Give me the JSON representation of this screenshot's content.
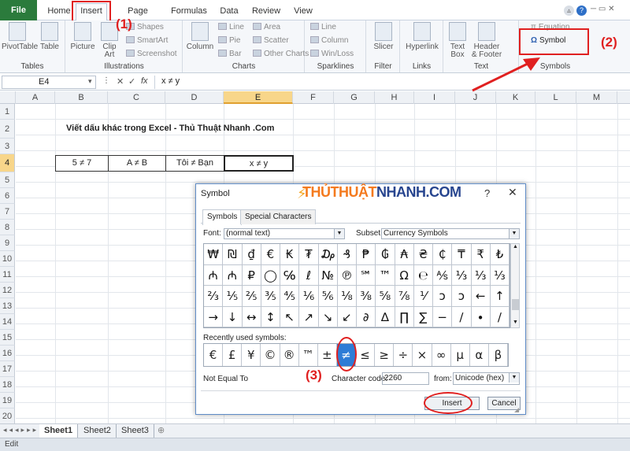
{
  "ribbon_tabs": [
    "File",
    "Home",
    "Insert",
    "Page Layout",
    "Formulas",
    "Data",
    "Review",
    "View"
  ],
  "ribbon": {
    "groups": {
      "tables": "Tables",
      "illustrations": "Illustrations",
      "charts": "Charts",
      "sparklines": "Sparklines",
      "filter": "Filter",
      "links": "Links",
      "text": "Text",
      "symbols": "Symbols"
    },
    "buttons": {
      "pivottable": "PivotTable",
      "table": "Table",
      "picture": "Picture",
      "clipart": "Clip Art",
      "shapes": "Shapes",
      "smartart": "SmartArt",
      "screenshot": "Screenshot",
      "column": "Column",
      "line": "Line",
      "pie": "Pie",
      "bar": "Bar",
      "area": "Area",
      "scatter": "Scatter",
      "other_charts": "Other Charts",
      "spark_line": "Line",
      "spark_column": "Column",
      "winloss": "Win/Loss",
      "slicer": "Slicer",
      "hyperlink": "Hyperlink",
      "textbox": "Text Box",
      "header_footer": "Header & Footer",
      "equation": "Equation",
      "symbol": "Symbol"
    }
  },
  "annotations": {
    "one": "(1)",
    "two": "(2)",
    "three": "(3)"
  },
  "formula_bar": {
    "name_box": "E4",
    "fx": "fx",
    "formula": "x ≠ y"
  },
  "columns": [
    "A",
    "B",
    "C",
    "D",
    "E",
    "F",
    "G",
    "H",
    "I",
    "J",
    "K",
    "L",
    "M"
  ],
  "rows": [
    "1",
    "2",
    "3",
    "4",
    "5",
    "6",
    "7",
    "8",
    "9",
    "10",
    "11",
    "12",
    "13",
    "14",
    "15",
    "16",
    "17",
    "18",
    "19",
    "20"
  ],
  "sheet": {
    "title": "Viết dấu khác trong Excel - Thủ Thuật Nhanh .Com",
    "cells": [
      "5 ≠ 7",
      "A ≠ B",
      "Tôi ≠ Bạn",
      "x ≠ y"
    ]
  },
  "sheet_tabs": [
    "Sheet1",
    "Sheet2",
    "Sheet3"
  ],
  "status": "Edit",
  "dialog": {
    "title": "Symbol",
    "brand_a": "THỦTHUẬT",
    "brand_b": "NHANH",
    "brand_c": ".COM",
    "help": "?",
    "close": "✕",
    "tabs": [
      "Symbols",
      "Special Characters"
    ],
    "font_label": "Font:",
    "font_value": "(normal text)",
    "subset_label": "Subset:",
    "subset_value": "Currency Symbols",
    "symbols": [
      "₩",
      "₪",
      "₫",
      "€",
      "₭",
      "₮",
      "₯",
      "₰",
      "₱",
      "₲",
      "₳",
      "₴",
      "₵",
      "₸",
      "₹",
      "₺",
      "₼",
      "₼",
      "₽",
      "◯",
      "℅",
      "ℓ",
      "№",
      "℗",
      "℠",
      "™",
      "Ω",
      "℮",
      "⅍",
      "⅓",
      "⅓",
      "⅓",
      "⅔",
      "⅕",
      "⅖",
      "⅗",
      "⅘",
      "⅙",
      "⅚",
      "⅛",
      "⅜",
      "⅝",
      "⅞",
      "⅟",
      "ↄ",
      "ↄ",
      "←",
      "↑",
      "→",
      "↓",
      "↔",
      "↕",
      "↖",
      "↗",
      "↘",
      "↙",
      "∂",
      "∆",
      "∏",
      "∑",
      "−",
      "∕",
      "∙",
      "∕"
    ],
    "recent_label": "Recently used symbols:",
    "recent": [
      "€",
      "£",
      "¥",
      "©",
      "®",
      "™",
      "±",
      "≠",
      "≤",
      "≥",
      "÷",
      "×",
      "∞",
      "µ",
      "α",
      "β"
    ],
    "symbol_name": "Not Equal To",
    "char_code_label": "Character code:",
    "char_code": "2260",
    "from_label": "from:",
    "from_value": "Unicode (hex)",
    "insert": "Insert",
    "cancel": "Cancel"
  }
}
